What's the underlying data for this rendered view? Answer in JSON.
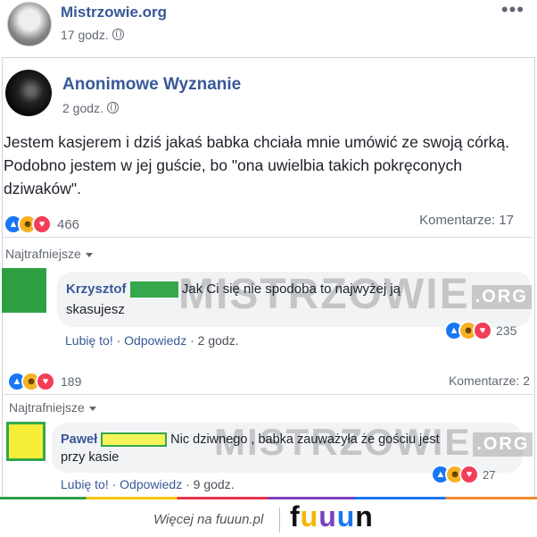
{
  "outer": {
    "page_name": "Mistrzowie.org",
    "time": "17 godz.",
    "more": "•••"
  },
  "post": {
    "author": "Anonimowe Wyznanie",
    "time": "2 godz.",
    "text": "Jestem kasjerem i dziś jakaś babka chciała mnie umówić ze swoją córką. Podobno jestem w jej guście, bo \"ona uwielbia takich pokręconych dziwaków\".",
    "reaction_count": "466",
    "comments_count": "Komentarze: 17",
    "sort": "Najtrafniejsze",
    "comment": {
      "name": "Krzysztof",
      "text_line1": "Jak Ci się nie spodoba to najwyżej ją",
      "text_line2": "skasujesz",
      "reaction_count": "235",
      "like": "Lubię to!",
      "reply": "Odpowiedz",
      "time": "2 godz.",
      "watermark": "MISTRZOWIE",
      "watermark_org": ".ORG"
    }
  },
  "outer_footer": {
    "reaction_count": "189",
    "comments_count": "Komentarze: 2",
    "sort": "Najtrafniejsze",
    "comment": {
      "name": "Paweł",
      "text_line1": "Nic dziwnego , babka zauważyła że gościu jest",
      "text_line2": "przy kasie",
      "reaction_count": "27",
      "like": "Lubię to!",
      "reply": "Odpowiedz",
      "time": "9 godz.",
      "watermark": "MISTRZOWIE",
      "watermark_org": ".ORG"
    }
  },
  "site_footer": {
    "more_text": "Więcej na fuuun.pl",
    "logo": [
      "f",
      "u",
      "u",
      "u",
      "n"
    ]
  },
  "colors": {
    "link_blue": "#385898",
    "censor_green": "#34a84a",
    "censor_yellow": "#f5ef3a"
  }
}
